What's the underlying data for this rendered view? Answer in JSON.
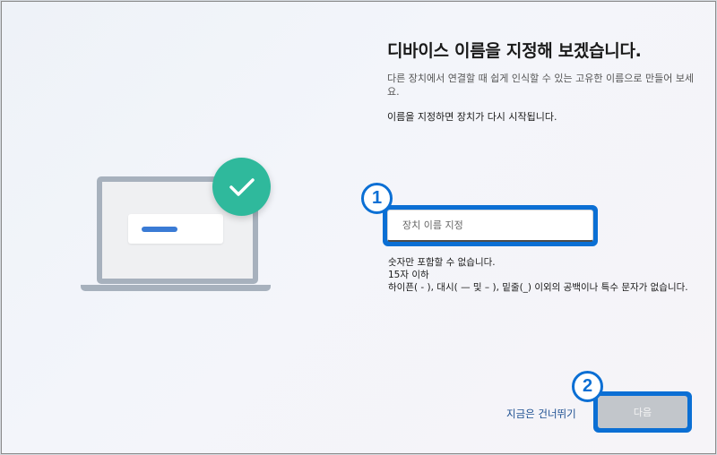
{
  "page": {
    "title": "디바이스 이름을 지정해 보겠습니다.",
    "description": "다른 장치에서 연결할 때 쉽게 인식할 수 있는 고유한 이름으로 만들어 보세요.",
    "restart_note": "이름을 지정하면 장치가 다시 시작됩니다."
  },
  "name_field": {
    "placeholder": "장치 이름 지정",
    "value": ""
  },
  "rules": [
    "숫자만 포함할 수 없습니다.",
    "15자 이하",
    "하이픈( - ), 대시( — 및 – ), 밑줄(_) 이외의 공백이나 특수 문자가 없습니다."
  ],
  "annotations": {
    "marker_1": "1",
    "marker_2": "2"
  },
  "footer": {
    "skip_label": "지금은 건너뛰기",
    "next_label": "다음"
  },
  "colors": {
    "accent": "#0b6fd4",
    "check_badge": "#2fb99c",
    "laptop_frame": "#a7b1bd",
    "next_disabled": "#c2c6cb"
  },
  "icons": {
    "illustration": "laptop-illustration",
    "badge": "checkmark-icon"
  }
}
